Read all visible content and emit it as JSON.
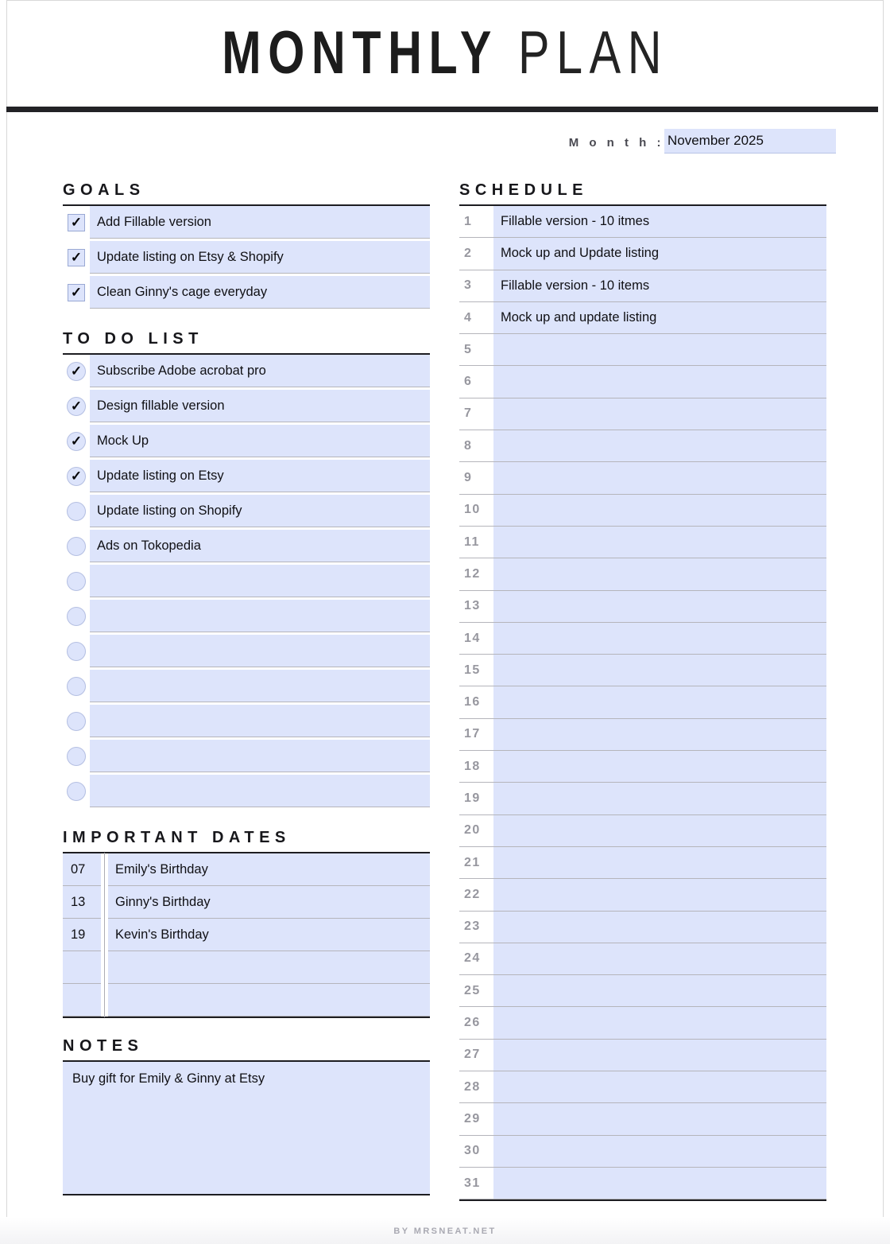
{
  "header": {
    "title_bold": "MONTHLY",
    "title_light": "PLAN"
  },
  "month": {
    "label": "M o n t h :",
    "value": "November 2025"
  },
  "goals": {
    "heading": "GOALS",
    "items": [
      {
        "checked": true,
        "text": "Add Fillable version"
      },
      {
        "checked": true,
        "text": "Update listing on Etsy & Shopify"
      },
      {
        "checked": true,
        "text": "Clean Ginny's cage everyday"
      }
    ]
  },
  "todo": {
    "heading": "TO DO LIST",
    "items": [
      {
        "checked": true,
        "text": "Subscribe Adobe acrobat pro"
      },
      {
        "checked": true,
        "text": "Design fillable version"
      },
      {
        "checked": true,
        "text": "Mock Up"
      },
      {
        "checked": true,
        "text": "Update listing on Etsy"
      },
      {
        "checked": false,
        "text": "Update listing on Shopify"
      },
      {
        "checked": false,
        "text": "Ads on Tokopedia"
      },
      {
        "checked": false,
        "text": ""
      },
      {
        "checked": false,
        "text": ""
      },
      {
        "checked": false,
        "text": ""
      },
      {
        "checked": false,
        "text": ""
      },
      {
        "checked": false,
        "text": ""
      },
      {
        "checked": false,
        "text": ""
      },
      {
        "checked": false,
        "text": ""
      }
    ]
  },
  "important_dates": {
    "heading": "IMPORTANT DATES",
    "rows": [
      {
        "day": "07",
        "event": "Emily's Birthday"
      },
      {
        "day": "13",
        "event": "Ginny's Birthday"
      },
      {
        "day": "19",
        "event": "Kevin's Birthday"
      },
      {
        "day": "",
        "event": ""
      },
      {
        "day": "",
        "event": ""
      }
    ]
  },
  "notes": {
    "heading": "NOTES",
    "text": "Buy gift for Emily & Ginny at Etsy"
  },
  "schedule": {
    "heading": "SCHEDULE",
    "rows": [
      {
        "day": "1",
        "text": "Fillable version - 10 itmes"
      },
      {
        "day": "2",
        "text": "Mock up and Update listing"
      },
      {
        "day": "3",
        "text": "Fillable version - 10 items"
      },
      {
        "day": "4",
        "text": "Mock up and update listing"
      },
      {
        "day": "5",
        "text": ""
      },
      {
        "day": "6",
        "text": ""
      },
      {
        "day": "7",
        "text": ""
      },
      {
        "day": "8",
        "text": ""
      },
      {
        "day": "9",
        "text": ""
      },
      {
        "day": "10",
        "text": ""
      },
      {
        "day": "11",
        "text": ""
      },
      {
        "day": "12",
        "text": ""
      },
      {
        "day": "13",
        "text": ""
      },
      {
        "day": "14",
        "text": ""
      },
      {
        "day": "15",
        "text": ""
      },
      {
        "day": "16",
        "text": ""
      },
      {
        "day": "17",
        "text": ""
      },
      {
        "day": "18",
        "text": ""
      },
      {
        "day": "19",
        "text": ""
      },
      {
        "day": "20",
        "text": ""
      },
      {
        "day": "21",
        "text": ""
      },
      {
        "day": "22",
        "text": ""
      },
      {
        "day": "23",
        "text": ""
      },
      {
        "day": "24",
        "text": ""
      },
      {
        "day": "25",
        "text": ""
      },
      {
        "day": "26",
        "text": ""
      },
      {
        "day": "27",
        "text": ""
      },
      {
        "day": "28",
        "text": ""
      },
      {
        "day": "29",
        "text": ""
      },
      {
        "day": "30",
        "text": ""
      },
      {
        "day": "31",
        "text": ""
      }
    ]
  },
  "footer": {
    "text": "BY MRSNEAT.NET"
  },
  "colors": {
    "field_blue": "#dde4fb",
    "rule_dark": "#1d1d21",
    "day_gray": "#97979f"
  }
}
